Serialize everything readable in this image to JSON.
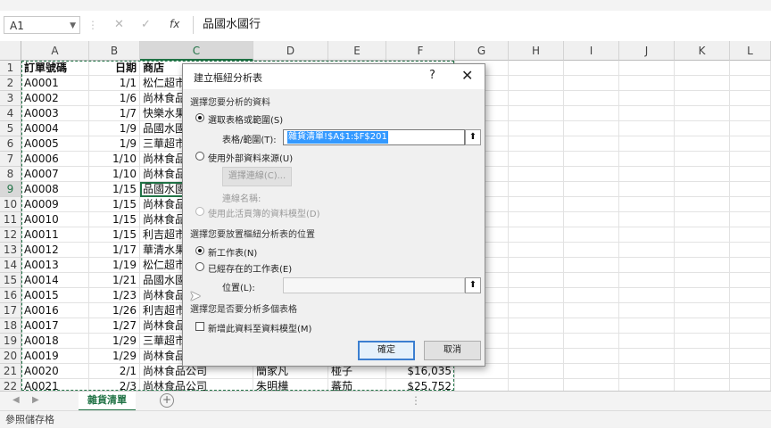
{
  "formula_bar": {
    "name_box": "A1",
    "cancel_glyph": "✕",
    "enter_glyph": "✓",
    "fx_label": "fx",
    "content": "品國水國行"
  },
  "columns": [
    "A",
    "B",
    "C",
    "D",
    "E",
    "F",
    "G",
    "H",
    "I",
    "J",
    "K",
    "L"
  ],
  "rows": [
    {
      "n": "1",
      "a": "訂單號碼",
      "b": "日期",
      "c": "商店",
      "d": "",
      "e": "",
      "f": ""
    },
    {
      "n": "2",
      "a": "A0001",
      "b": "1/1",
      "c": "松仁超市",
      "d": "",
      "e": "",
      "f": ""
    },
    {
      "n": "3",
      "a": "A0002",
      "b": "1/6",
      "c": "尚林食品",
      "d": "",
      "e": "",
      "f": ""
    },
    {
      "n": "4",
      "a": "A0003",
      "b": "1/7",
      "c": "快樂水果",
      "d": "",
      "e": "",
      "f": ""
    },
    {
      "n": "5",
      "a": "A0004",
      "b": "1/9",
      "c": "品國水國",
      "d": "",
      "e": "",
      "f": ""
    },
    {
      "n": "6",
      "a": "A0005",
      "b": "1/9",
      "c": "三華超市",
      "d": "",
      "e": "",
      "f": ""
    },
    {
      "n": "7",
      "a": "A0006",
      "b": "1/10",
      "c": "尚林食品",
      "d": "",
      "e": "",
      "f": ""
    },
    {
      "n": "8",
      "a": "A0007",
      "b": "1/10",
      "c": "尚林食品",
      "d": "",
      "e": "",
      "f": ""
    },
    {
      "n": "9",
      "a": "A0008",
      "b": "1/15",
      "c": "品國水國",
      "d": "",
      "e": "",
      "f": ""
    },
    {
      "n": "10",
      "a": "A0009",
      "b": "1/15",
      "c": "尚林食品",
      "d": "",
      "e": "",
      "f": ""
    },
    {
      "n": "11",
      "a": "A0010",
      "b": "1/15",
      "c": "尚林食品",
      "d": "",
      "e": "",
      "f": ""
    },
    {
      "n": "12",
      "a": "A0011",
      "b": "1/15",
      "c": "利吉超市",
      "d": "",
      "e": "",
      "f": ""
    },
    {
      "n": "13",
      "a": "A0012",
      "b": "1/17",
      "c": "華清水果",
      "d": "",
      "e": "",
      "f": ""
    },
    {
      "n": "14",
      "a": "A0013",
      "b": "1/19",
      "c": "松仁超市",
      "d": "",
      "e": "",
      "f": ""
    },
    {
      "n": "15",
      "a": "A0014",
      "b": "1/21",
      "c": "品國水國",
      "d": "",
      "e": "",
      "f": ""
    },
    {
      "n": "16",
      "a": "A0015",
      "b": "1/23",
      "c": "尚林食品",
      "d": "",
      "e": "",
      "f": ""
    },
    {
      "n": "17",
      "a": "A0016",
      "b": "1/26",
      "c": "利吉超市",
      "d": "",
      "e": "",
      "f": ""
    },
    {
      "n": "18",
      "a": "A0017",
      "b": "1/27",
      "c": "尚林食品",
      "d": "",
      "e": "",
      "f": ""
    },
    {
      "n": "19",
      "a": "A0018",
      "b": "1/29",
      "c": "三華超市",
      "d": "",
      "e": "",
      "f": ""
    },
    {
      "n": "20",
      "a": "A0019",
      "b": "1/29",
      "c": "尚林食品",
      "d": "",
      "e": "",
      "f": ""
    },
    {
      "n": "21",
      "a": "A0020",
      "b": "2/1",
      "c": "尚林食品公司",
      "d": "簡家凡",
      "e": "椪子",
      "f": "$16,035"
    },
    {
      "n": "22",
      "a": "A0021",
      "b": "2/3",
      "c": "尚林食品公司",
      "d": "朱明樺",
      "e": "蕃茄",
      "f": "$25,752"
    }
  ],
  "sheet_tab": "雜貨清單",
  "sheet_nav": {
    "prev": "◀",
    "next": "▶",
    "add": "+",
    "more": "⋮"
  },
  "status": "參照儲存格",
  "dialog": {
    "title": "建立樞紐分析表",
    "help": "?",
    "close": "✕",
    "section_data": "選擇您要分析的資料",
    "opt_select_range": "選取表格或範圍(S)",
    "range_label": "表格/範圍(T):",
    "range_value": "雜貨清單!$A$1:$F$201",
    "opt_external": "使用外部資料來源(U)",
    "choose_conn_btn": "選擇連線(C)...",
    "conn_name_label": "連線名稱:",
    "opt_data_model": "使用此活頁簿的資料模型(D)",
    "section_location": "選擇您要放置樞紐分析表的位置",
    "opt_new_sheet": "新工作表(N)",
    "opt_existing_sheet": "已經存在的工作表(E)",
    "location_label": "位置(L):",
    "section_multi": "選擇您是否要分析多個表格",
    "add_to_model": "新增此資料至資料模型(M)",
    "ok": "確定",
    "cancel": "取消",
    "collapse_glyph": "⬆"
  },
  "colors": {
    "excel_green": "#217346",
    "selection_blue": "#3399ff"
  }
}
